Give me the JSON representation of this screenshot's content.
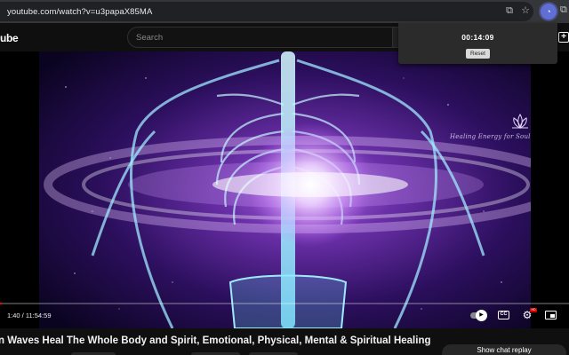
{
  "browser": {
    "url": "youtube.com/watch?v=u3papaX85MA",
    "icons": [
      "cast-icon",
      "star-icon",
      "timer-extension-icon",
      "extensions-icon"
    ]
  },
  "masthead": {
    "logo_fragment": "ube",
    "search_placeholder": "Search"
  },
  "timer_popup": {
    "time": "00:14:09",
    "reset_label": "Reset"
  },
  "video": {
    "watermark": "Healing Energy for Soul",
    "current_time": "1:40",
    "duration": "11:54:59",
    "time_display": "1:40 / 11:54:59",
    "progress": 0.0023,
    "colors": {
      "progress": "#ff0000",
      "background": "#0f0f0f"
    }
  },
  "below_video": {
    "title": "n Waves Heal The Whole Body and Spirit, Emotional, Physical, Mental & Spiritual Healing",
    "chat_replay_label": "Show chat replay"
  }
}
